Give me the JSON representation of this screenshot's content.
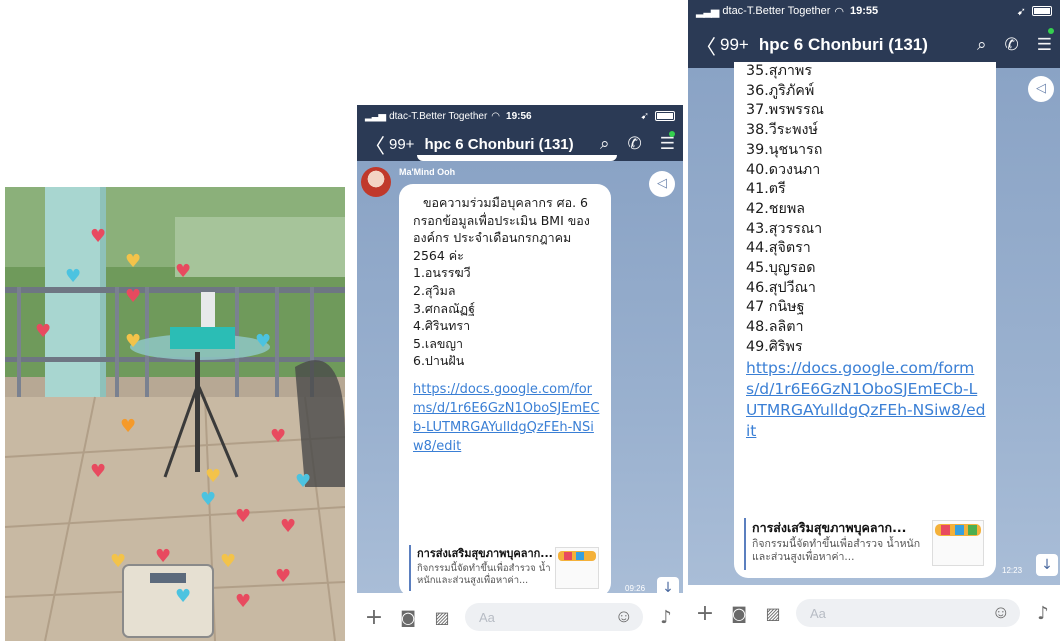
{
  "middle_phone": {
    "status": {
      "carrier": "dtac-T.Better Together",
      "time": "19:56"
    },
    "nav": {
      "back": "〈",
      "count": "99+",
      "title": "hpc 6 Chonburi (131)"
    },
    "sender": "Ma'Mind Ooh",
    "message": {
      "lines": [
        "ขอความร่วมมือบุคลากร ศอ. 6",
        "กรอกข้อมูลเพื่อประเมิน BMI ของ",
        "องค์กร ประจำเดือนกรกฎาคม",
        "2564 ค่ะ",
        "1.อนรรฆวี",
        "2.สุวิมล",
        "3.ศกลณัฏฐ์",
        "4.ศิรินทรา",
        "5.เลขญา",
        "6.ปานฝัน"
      ],
      "link": "https://docs.google.com/forms/d/1r6E6GzN1OboSJEmECb-LUTMRGAYulldgQzFEh-NSiw8/edit",
      "preview_title": "การส่งเสริมสุขภาพบุคลาก...",
      "preview_desc": "กิจกรรมนี้จัดทำขึ้นเพื่อสำรวจ น้ำหนักและส่วนสูงเพื่อหาค่า..."
    },
    "timestamp": "09:26",
    "input_placeholder": "Aa"
  },
  "right_phone": {
    "status": {
      "carrier": "dtac-T.Better Together",
      "time": "19:55"
    },
    "nav": {
      "back": "〈",
      "count": "99+",
      "title": "hpc 6 Chonburi (131)"
    },
    "message": {
      "lines": [
        "35.สุภาพร",
        "36.ภูริภัคพ์",
        "37.พรพรรณ",
        "38.วีระพงษ์",
        "39.นุชนารถ",
        "40.ดวงนภา",
        "41.ตรี",
        "42.ชยพล",
        "43.สุวรรณา",
        "44.สุจิตรา",
        "45.บุญรอด",
        "46.สุปวีณา",
        "47 กนิษฐ",
        "48.ลลิตา",
        "49.ศิริพร"
      ],
      "link": "https://docs.google.com/forms/d/1r6E6GzN1OboSJEmECb-LUTMRGAYulldgQzFEh-NSiw8/edit",
      "preview_title": "การส่งเสริมสุขภาพบุคลาก...",
      "preview_desc": "กิจกรรมนี้จัดทำขึ้นเพื่อสำรวจ น้ำหนักและส่วนสูงเพื่อหาค่า..."
    },
    "timestamp": "12:23",
    "input_placeholder": "Aa"
  },
  "colors": {
    "header": "#2b3a55",
    "chat_bg": "#8ea5c6",
    "link": "#3a7fd5",
    "heart": "#e84a5f"
  }
}
